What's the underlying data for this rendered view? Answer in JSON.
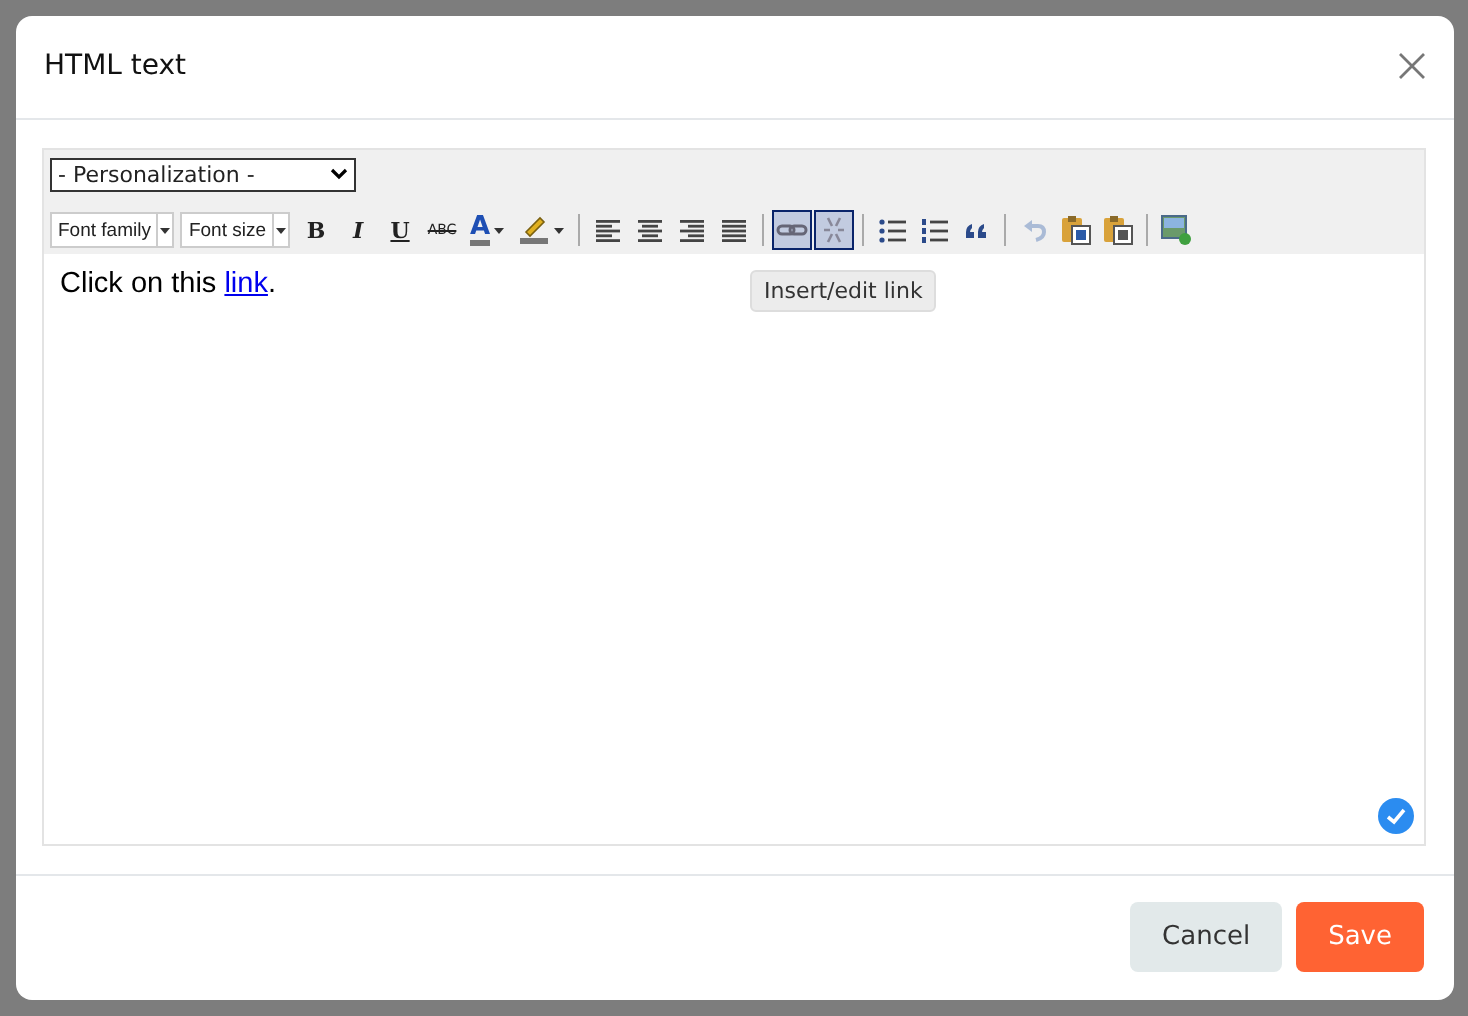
{
  "dialog": {
    "title": "HTML text"
  },
  "editor": {
    "personalization": "- Personalization -",
    "toolbar": [
      {
        "kind": "select",
        "label": "Font family"
      },
      {
        "kind": "select",
        "label": "Font size"
      },
      {
        "kind": "bold",
        "label": "B",
        "active": false,
        "disabled": false
      },
      {
        "kind": "italic",
        "label": "I",
        "active": false,
        "disabled": false
      },
      {
        "kind": "underline",
        "label": "U",
        "active": false,
        "disabled": false
      },
      {
        "kind": "strike",
        "label": "ABC",
        "active": false,
        "disabled": false
      },
      {
        "kind": "forecolor",
        "label": "A",
        "active": false,
        "disabled": false
      },
      {
        "kind": "backcolor",
        "active": false,
        "disabled": false
      },
      {
        "kind": "separator"
      },
      {
        "kind": "align-left",
        "active": false,
        "disabled": false
      },
      {
        "kind": "align-center",
        "active": false,
        "disabled": false
      },
      {
        "kind": "align-right",
        "active": false,
        "disabled": false
      },
      {
        "kind": "justify",
        "active": false,
        "disabled": false
      },
      {
        "kind": "separator"
      },
      {
        "kind": "link",
        "active": true,
        "disabled": false
      },
      {
        "kind": "unlink",
        "active": true,
        "disabled": false
      },
      {
        "kind": "separator"
      },
      {
        "kind": "bullist",
        "active": false,
        "disabled": false
      },
      {
        "kind": "numlist",
        "active": false,
        "disabled": false
      },
      {
        "kind": "quote",
        "active": false,
        "disabled": false
      },
      {
        "kind": "separator"
      },
      {
        "kind": "undo",
        "active": false,
        "disabled": true
      },
      {
        "kind": "paste-word",
        "active": false,
        "disabled": false
      },
      {
        "kind": "paste-text",
        "active": false,
        "disabled": false
      },
      {
        "kind": "separator"
      },
      {
        "kind": "image",
        "active": false,
        "disabled": false
      }
    ],
    "tooltip": "Insert/edit link",
    "content": {
      "before": "Click on this ",
      "link": "link",
      "after": "."
    }
  },
  "buttons": [
    {
      "kind": "secondary",
      "label": "Cancel"
    },
    {
      "kind": "primary",
      "label": "Save"
    }
  ]
}
